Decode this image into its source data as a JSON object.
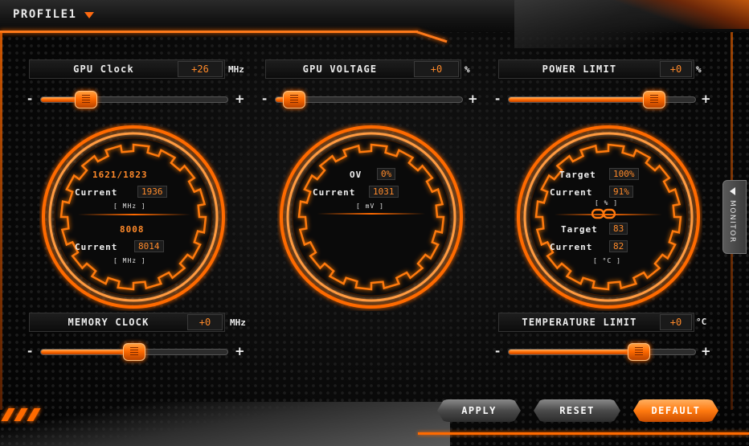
{
  "profile": {
    "label": "PROFILE1"
  },
  "controls": {
    "gpu_clock": {
      "label": "GPU Clock",
      "value": "+26",
      "unit": "MHz",
      "level": 0.24
    },
    "gpu_voltage": {
      "label": "GPU VOLTAGE",
      "value": "+0",
      "unit": "%",
      "level": 0.1
    },
    "power_limit": {
      "label": "POWER LIMIT",
      "value": "+0",
      "unit": "%",
      "level": 0.78
    },
    "memory_clock": {
      "label": "MEMORY CLOCK",
      "value": "+0",
      "unit": "MHz",
      "level": 0.5
    },
    "temperature_limit": {
      "label": "TEMPERATURE LIMIT",
      "value": "+0",
      "unit": "°C",
      "level": 0.7
    },
    "minus": "-",
    "plus": "+"
  },
  "gauge_clock": {
    "gpu_boost": "1621/1823",
    "current_label": "Current",
    "gpu_current": "1936",
    "unit1": "[ MHz ]",
    "mem_clock": "8008",
    "mem_current_label": "Current",
    "mem_current": "8014",
    "unit2": "[ MHz ]"
  },
  "gauge_voltage": {
    "ov_label": "OV",
    "ov_value": "0%",
    "current_label": "Current",
    "current_value": "1031",
    "unit": "[ mV ]"
  },
  "gauge_power": {
    "target_label": "Target",
    "target_value": "100%",
    "current_label": "Current",
    "current_value": "91%",
    "unit1": "[ % ]",
    "temp_target_label": "Target",
    "temp_target_value": "83",
    "temp_current_label": "Current",
    "temp_current_value": "82",
    "unit2": "[ °C ]"
  },
  "monitor": {
    "label": "MONITOR"
  },
  "buttons": {
    "apply": "APPLY",
    "reset": "RESET",
    "default": "DEFAULT"
  },
  "colors": {
    "accent": "#ff6a00",
    "value_text": "#ff8a2a"
  }
}
